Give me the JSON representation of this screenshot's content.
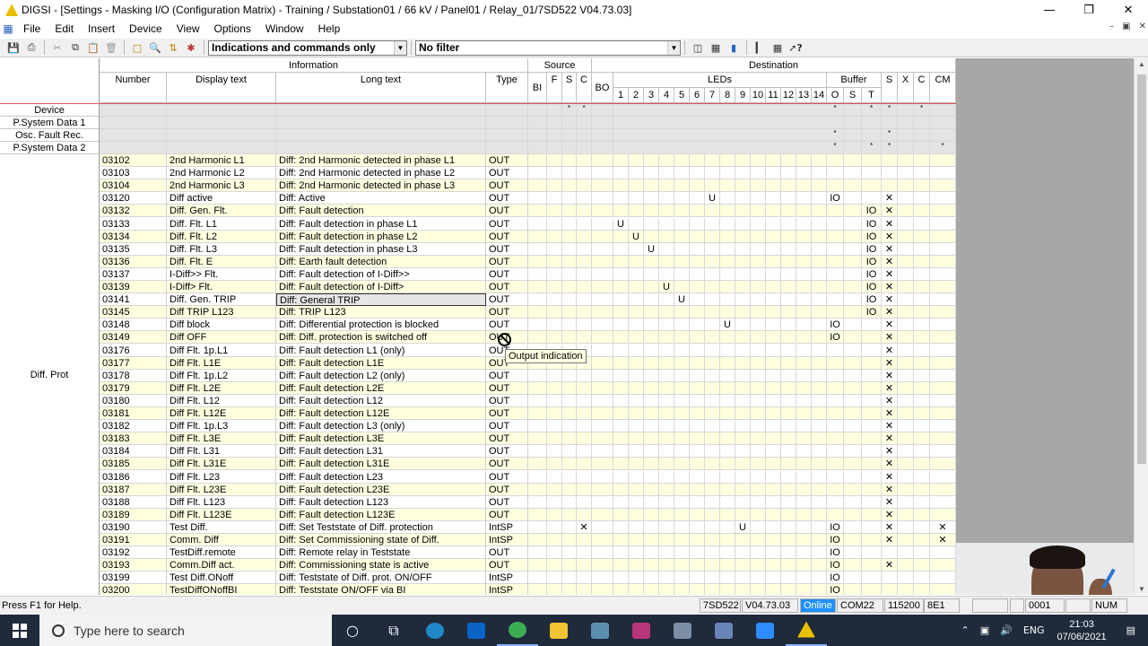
{
  "window": {
    "title": "DIGSI - [Settings - Masking I/O (Configuration Matrix) - Training / Substation01 / 66 kV / Panel01 / Relay_01/7SD522 V04.73.03]",
    "controls": [
      "—",
      "❐",
      "✕"
    ]
  },
  "menu": {
    "items": [
      "File",
      "Edit",
      "Insert",
      "Device",
      "View",
      "Options",
      "Window",
      "Help"
    ],
    "mdi_controls": [
      "–",
      "▣",
      "✕"
    ]
  },
  "toolbar": {
    "view_select": "Indications and commands only",
    "filter_select": "No filter"
  },
  "headers": {
    "information": "Information",
    "source": "Source",
    "destination": "Destination",
    "number": "Number",
    "display_text": "Display text",
    "long_text": "Long text",
    "type": "Type",
    "bi": "BI",
    "f": "F",
    "s": "S",
    "c": "C",
    "bo": "BO",
    "leds": "LEDs",
    "led_numbers": [
      "1",
      "2",
      "3",
      "4",
      "5",
      "6",
      "7",
      "8",
      "9",
      "10",
      "11",
      "12",
      "13",
      "14"
    ],
    "buffer": "Buffer",
    "buf_o": "O",
    "buf_s": "S",
    "buf_t": "T",
    "dest_s": "S",
    "dest_x": "X",
    "dest_c": "C",
    "cm": "CM"
  },
  "groups": [
    {
      "label": "Device"
    },
    {
      "label": "P.System Data 1"
    },
    {
      "label": "Osc. Fault Rec."
    },
    {
      "label": "P.System Data 2"
    },
    {
      "label": "Diff. Prot"
    }
  ],
  "group_marks": [
    {
      "f": "",
      "s": "*",
      "c": "*",
      "o": "*",
      "t": "*",
      "ds": "*",
      "dc": "*",
      "cm": ""
    },
    {
      "f": "",
      "s": "",
      "c": "",
      "o": "",
      "t": "",
      "ds": "",
      "dc": "",
      "cm": ""
    },
    {
      "f": "",
      "s": "",
      "c": "",
      "o": "*",
      "t": "",
      "ds": "*",
      "dc": "",
      "cm": ""
    },
    {
      "f": "",
      "s": "",
      "c": "",
      "o": "*",
      "t": "*",
      "ds": "*",
      "dc": "",
      "cm": "*"
    }
  ],
  "rows": [
    {
      "num": "03102",
      "disp": "2nd Harmonic L1",
      "long": "Diff: 2nd Harmonic detected in phase L1",
      "type": "OUT",
      "c_src": "",
      "led": "",
      "led_col": 0,
      "o": "",
      "t": "",
      "x": "",
      "cm": ""
    },
    {
      "num": "03103",
      "disp": "2nd Harmonic L2",
      "long": "Diff: 2nd Harmonic detected in phase L2",
      "type": "OUT",
      "c_src": "",
      "led": "",
      "led_col": 0,
      "o": "",
      "t": "",
      "x": "",
      "cm": ""
    },
    {
      "num": "03104",
      "disp": "2nd Harmonic L3",
      "long": "Diff: 2nd Harmonic detected in phase L3",
      "type": "OUT",
      "c_src": "",
      "led": "",
      "led_col": 0,
      "o": "",
      "t": "",
      "x": "",
      "cm": ""
    },
    {
      "num": "03120",
      "disp": "Diff active",
      "long": "Diff: Active",
      "type": "OUT",
      "c_src": "",
      "led": "U",
      "led_col": 7,
      "o": "IO",
      "t": "",
      "x": "✕",
      "cm": ""
    },
    {
      "num": "03132",
      "disp": "Diff. Gen. Flt.",
      "long": "Diff: Fault detection",
      "type": "OUT",
      "c_src": "",
      "led": "",
      "led_col": 0,
      "o": "",
      "t": "IO",
      "x": "✕",
      "cm": ""
    },
    {
      "num": "03133",
      "disp": "Diff. Flt. L1",
      "long": "Diff: Fault detection in phase L1",
      "type": "OUT",
      "c_src": "",
      "led": "U",
      "led_col": 1,
      "o": "",
      "t": "IO",
      "x": "✕",
      "cm": ""
    },
    {
      "num": "03134",
      "disp": "Diff. Flt. L2",
      "long": "Diff: Fault detection in phase L2",
      "type": "OUT",
      "c_src": "",
      "led": "U",
      "led_col": 2,
      "o": "",
      "t": "IO",
      "x": "✕",
      "cm": ""
    },
    {
      "num": "03135",
      "disp": "Diff. Flt. L3",
      "long": "Diff: Fault detection in phase L3",
      "type": "OUT",
      "c_src": "",
      "led": "U",
      "led_col": 3,
      "o": "",
      "t": "IO",
      "x": "✕",
      "cm": ""
    },
    {
      "num": "03136",
      "disp": "Diff. Flt. E",
      "long": "Diff: Earth fault detection",
      "type": "OUT",
      "c_src": "",
      "led": "",
      "led_col": 0,
      "o": "",
      "t": "IO",
      "x": "✕",
      "cm": ""
    },
    {
      "num": "03137",
      "disp": "I-Diff>> Flt.",
      "long": "Diff: Fault detection of I-Diff>>",
      "type": "OUT",
      "c_src": "",
      "led": "",
      "led_col": 0,
      "o": "",
      "t": "IO",
      "x": "✕",
      "cm": ""
    },
    {
      "num": "03139",
      "disp": "I-Diff> Flt.",
      "long": "Diff: Fault detection of I-Diff>",
      "type": "OUT",
      "c_src": "",
      "led": "U",
      "led_col": 4,
      "o": "",
      "t": "IO",
      "x": "✕",
      "cm": ""
    },
    {
      "num": "03141",
      "disp": "Diff. Gen. TRIP",
      "long": "Diff: General TRIP",
      "type": "OUT",
      "c_src": "",
      "led": "U",
      "led_col": 5,
      "o": "",
      "t": "IO",
      "x": "✕",
      "cm": ""
    },
    {
      "num": "03145",
      "disp": "Diff TRIP L123",
      "long": "Diff: TRIP L123",
      "type": "OUT",
      "c_src": "",
      "led": "",
      "led_col": 0,
      "o": "",
      "t": "IO",
      "x": "✕",
      "cm": ""
    },
    {
      "num": "03148",
      "disp": "Diff block",
      "long": "Diff: Differential protection is blocked",
      "type": "OUT",
      "c_src": "",
      "led": "U",
      "led_col": 8,
      "o": "IO",
      "t": "",
      "x": "✕",
      "cm": ""
    },
    {
      "num": "03149",
      "disp": "Diff OFF",
      "long": "Diff: Diff. protection is switched off",
      "type": "OUT",
      "c_src": "",
      "led": "",
      "led_col": 0,
      "o": "IO",
      "t": "",
      "x": "✕",
      "cm": ""
    },
    {
      "num": "03176",
      "disp": "Diff Flt. 1p.L1",
      "long": "Diff: Fault detection L1 (only)",
      "type": "OUT",
      "c_src": "",
      "led": "",
      "led_col": 0,
      "o": "",
      "t": "",
      "x": "✕",
      "cm": ""
    },
    {
      "num": "03177",
      "disp": "Diff Flt. L1E",
      "long": "Diff: Fault detection L1E",
      "type": "OUT",
      "c_src": "",
      "led": "",
      "led_col": 0,
      "o": "",
      "t": "",
      "x": "✕",
      "cm": ""
    },
    {
      "num": "03178",
      "disp": "Diff Flt. 1p.L2",
      "long": "Diff: Fault detection L2 (only)",
      "type": "OUT",
      "c_src": "",
      "led": "",
      "led_col": 0,
      "o": "",
      "t": "",
      "x": "✕",
      "cm": ""
    },
    {
      "num": "03179",
      "disp": "Diff Flt. L2E",
      "long": "Diff: Fault detection L2E",
      "type": "OUT",
      "c_src": "",
      "led": "",
      "led_col": 0,
      "o": "",
      "t": "",
      "x": "✕",
      "cm": ""
    },
    {
      "num": "03180",
      "disp": "Diff Flt. L12",
      "long": "Diff: Fault detection L12",
      "type": "OUT",
      "c_src": "",
      "led": "",
      "led_col": 0,
      "o": "",
      "t": "",
      "x": "✕",
      "cm": ""
    },
    {
      "num": "03181",
      "disp": "Diff Flt. L12E",
      "long": "Diff: Fault detection L12E",
      "type": "OUT",
      "c_src": "",
      "led": "",
      "led_col": 0,
      "o": "",
      "t": "",
      "x": "✕",
      "cm": ""
    },
    {
      "num": "03182",
      "disp": "Diff Flt. 1p.L3",
      "long": "Diff: Fault detection L3 (only)",
      "type": "OUT",
      "c_src": "",
      "led": "",
      "led_col": 0,
      "o": "",
      "t": "",
      "x": "✕",
      "cm": ""
    },
    {
      "num": "03183",
      "disp": "Diff Flt. L3E",
      "long": "Diff: Fault detection L3E",
      "type": "OUT",
      "c_src": "",
      "led": "",
      "led_col": 0,
      "o": "",
      "t": "",
      "x": "✕",
      "cm": ""
    },
    {
      "num": "03184",
      "disp": "Diff Flt. L31",
      "long": "Diff: Fault detection L31",
      "type": "OUT",
      "c_src": "",
      "led": "",
      "led_col": 0,
      "o": "",
      "t": "",
      "x": "✕",
      "cm": ""
    },
    {
      "num": "03185",
      "disp": "Diff Flt. L31E",
      "long": "Diff: Fault detection L31E",
      "type": "OUT",
      "c_src": "",
      "led": "",
      "led_col": 0,
      "o": "",
      "t": "",
      "x": "✕",
      "cm": ""
    },
    {
      "num": "03186",
      "disp": "Diff Flt. L23",
      "long": "Diff: Fault detection L23",
      "type": "OUT",
      "c_src": "",
      "led": "",
      "led_col": 0,
      "o": "",
      "t": "",
      "x": "✕",
      "cm": ""
    },
    {
      "num": "03187",
      "disp": "Diff Flt. L23E",
      "long": "Diff: Fault detection L23E",
      "type": "OUT",
      "c_src": "",
      "led": "",
      "led_col": 0,
      "o": "",
      "t": "",
      "x": "✕",
      "cm": ""
    },
    {
      "num": "03188",
      "disp": "Diff Flt. L123",
      "long": "Diff: Fault detection L123",
      "type": "OUT",
      "c_src": "",
      "led": "",
      "led_col": 0,
      "o": "",
      "t": "",
      "x": "✕",
      "cm": ""
    },
    {
      "num": "03189",
      "disp": "Diff Flt. L123E",
      "long": "Diff: Fault detection L123E",
      "type": "OUT",
      "c_src": "",
      "led": "",
      "led_col": 0,
      "o": "",
      "t": "",
      "x": "✕",
      "cm": ""
    },
    {
      "num": "03190",
      "disp": "Test Diff.",
      "long": "Diff: Set Teststate of Diff. protection",
      "type": "IntSP",
      "c_src": "✕",
      "led": "U",
      "led_col": 9,
      "o": "IO",
      "t": "",
      "x": "✕",
      "cm": "✕"
    },
    {
      "num": "03191",
      "disp": "Comm. Diff",
      "long": "Diff: Set Commissioning state of Diff.",
      "type": "IntSP",
      "c_src": "",
      "led": "",
      "led_col": 0,
      "o": "IO",
      "t": "",
      "x": "✕",
      "cm": "✕"
    },
    {
      "num": "03192",
      "disp": "TestDiff.remote",
      "long": "Diff: Remote relay in Teststate",
      "type": "OUT",
      "c_src": "",
      "led": "",
      "led_col": 0,
      "o": "IO",
      "t": "",
      "x": "",
      "cm": ""
    },
    {
      "num": "03193",
      "disp": "Comm.Diff act.",
      "long": "Diff: Commissioning state is active",
      "type": "OUT",
      "c_src": "",
      "led": "",
      "led_col": 0,
      "o": "IO",
      "t": "",
      "x": "✕",
      "cm": ""
    },
    {
      "num": "03199",
      "disp": "Test Diff.ONoff",
      "long": "Diff: Teststate of Diff. prot. ON/OFF",
      "type": "IntSP",
      "c_src": "",
      "led": "",
      "led_col": 0,
      "o": "IO",
      "t": "",
      "x": "",
      "cm": ""
    },
    {
      "num": "03200",
      "disp": "TestDiffONoffBI",
      "long": "Diff: Teststate ON/OFF via BI",
      "type": "IntSP",
      "c_src": "",
      "led": "",
      "led_col": 0,
      "o": "IO",
      "t": "",
      "x": "",
      "cm": ""
    }
  ],
  "tooltip": "Output indication",
  "status": {
    "help": "Press F1 for Help.",
    "device": "7SD522",
    "version": "V04.73.03",
    "online": "Online",
    "port": "COM22",
    "baud": "115200",
    "format": "8E1",
    "address": "0001",
    "num": "NUM",
    "online_color": "#1e90ff"
  },
  "taskbar": {
    "search_placeholder": "Type here to search",
    "lang": "ENG",
    "time": "21:03",
    "date": "07/06/2021"
  }
}
